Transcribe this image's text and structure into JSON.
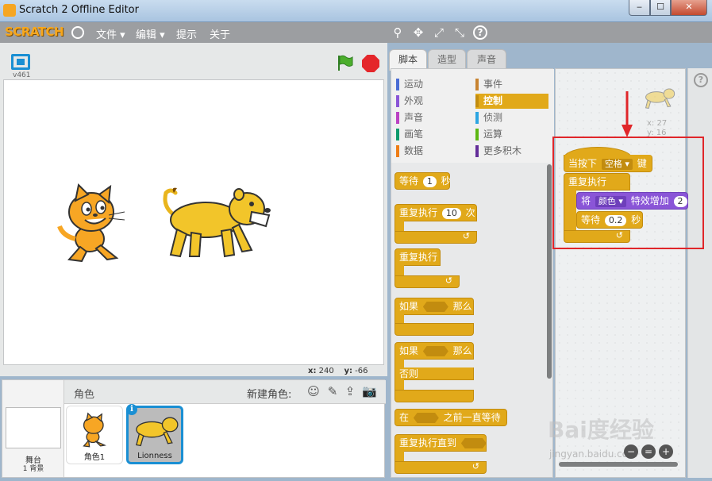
{
  "window": {
    "title": "Scratch 2 Offline Editor",
    "controls": {
      "minimize": "‒",
      "maximize": "☐",
      "close": "✕"
    }
  },
  "menubar": {
    "logo": "SCRATCH",
    "items": [
      "文件 ▾",
      "编辑 ▾",
      "提示",
      "关于"
    ],
    "tools": [
      "⚲",
      "✥",
      "⤢",
      "⤡",
      "?"
    ]
  },
  "stage": {
    "version": "v461",
    "coords": {
      "x_label": "x:",
      "x_value": "240",
      "y_label": "y:",
      "y_value": "-66"
    }
  },
  "sprites": {
    "header_label": "角色",
    "new_sprite_label": "新建角色:",
    "new_icons": [
      "☺",
      "✎",
      "⇪",
      "📷"
    ],
    "stage_thumb": {
      "label": "舞台",
      "count": "1 背景"
    },
    "items": [
      {
        "name": "角色1"
      },
      {
        "name": "Lionness"
      }
    ],
    "info_badge": "i"
  },
  "tabs": [
    {
      "label": "脚本",
      "active": true
    },
    {
      "label": "造型",
      "active": false
    },
    {
      "label": "声音",
      "active": false
    }
  ],
  "categories": [
    {
      "label": "运动",
      "color": "#4a6cd4"
    },
    {
      "label": "事件",
      "color": "#c88330"
    },
    {
      "label": "外观",
      "color": "#8a55d7"
    },
    {
      "label": "控制",
      "color": "#e1a91a",
      "selected": true
    },
    {
      "label": "声音",
      "color": "#bb42c3"
    },
    {
      "label": "侦测",
      "color": "#2ca5e2"
    },
    {
      "label": "画笔",
      "color": "#0e9a6c"
    },
    {
      "label": "运算",
      "color": "#5cb712"
    },
    {
      "label": "数据",
      "color": "#ee7d16"
    },
    {
      "label": "更多积木",
      "color": "#632d99"
    }
  ],
  "palette_blocks": {
    "wait": {
      "label": "等待",
      "value": "1",
      "unit": "秒"
    },
    "repeat": {
      "label": "重复执行",
      "value": "10",
      "unit": "次"
    },
    "forever": {
      "label": "重复执行"
    },
    "if_then": {
      "label": "如果",
      "then": "那么"
    },
    "if_else": {
      "label": "如果",
      "then": "那么",
      "else": "否则"
    },
    "wait_until": {
      "label": "在",
      "suffix": "之前一直等待"
    },
    "repeat_until": {
      "label": "重复执行直到"
    },
    "loop_arrow": "↺"
  },
  "script": {
    "sprite_x": "x: 27",
    "sprite_y": "y: 16",
    "hat": {
      "label": "当按下",
      "key": "空格 ▾",
      "suffix": "键"
    },
    "forever": {
      "label": "重复执行"
    },
    "effect": {
      "label": "将",
      "effect": "颜色 ▾",
      "middle": "特效增加",
      "value": "2"
    },
    "wait": {
      "label": "等待",
      "value": "0.2",
      "unit": "秒"
    }
  },
  "help_icon": "?",
  "zoom": [
    "−",
    "=",
    "+"
  ],
  "watermark": {
    "main": "Bai度经验",
    "sub": "jingyan.baidu.com"
  },
  "colors": {
    "control": "#e1a91a",
    "looks": "#8a55d7",
    "highlight": "#e0262a",
    "accent": "#1a8fd3"
  }
}
